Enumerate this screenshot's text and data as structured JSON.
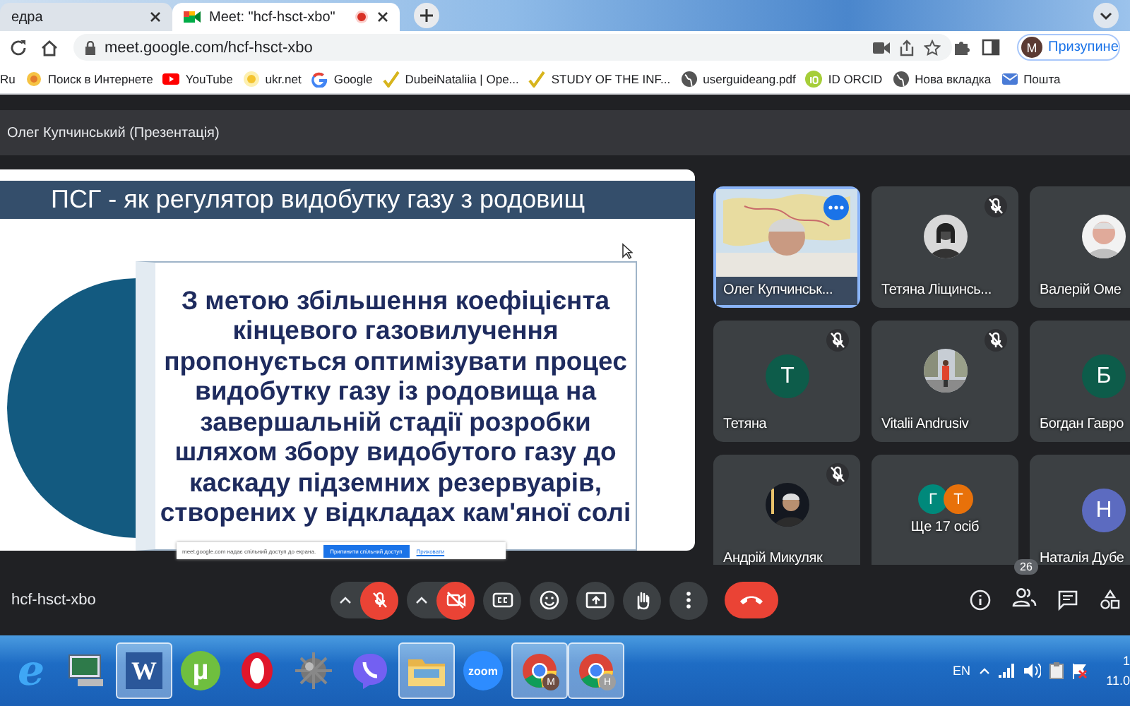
{
  "browser": {
    "tabs": [
      {
        "title": "едра",
        "selected": false,
        "recording": false
      },
      {
        "title": "Meet: \"hcf-hsct-xbo\"",
        "selected": true,
        "recording": true
      }
    ],
    "address": "meet.google.com/hcf-hsct-xbo",
    "profile": {
      "initial": "M",
      "label": "Призупине"
    },
    "bookmarks": [
      {
        "label": "Ru",
        "kind": "none"
      },
      {
        "label": "Поиск в Интернете",
        "kind": "search"
      },
      {
        "label": "YouTube",
        "kind": "youtube"
      },
      {
        "label": "ukr.net",
        "kind": "ukrnet"
      },
      {
        "label": "Google",
        "kind": "google"
      },
      {
        "label": "DubeiNataliia | Ope...",
        "kind": "pen"
      },
      {
        "label": "STUDY OF THE INF...",
        "kind": "pen"
      },
      {
        "label": "userguideang.pdf",
        "kind": "globe"
      },
      {
        "label": "ID ORCID",
        "kind": "orcid"
      },
      {
        "label": "Нова вкладка",
        "kind": "globe"
      },
      {
        "label": "Пошта",
        "kind": "mail"
      }
    ]
  },
  "meet": {
    "header_title": "Олег Купчинський (Презентація)",
    "slide": {
      "title": "ПСГ - як регулятор видобутку газу з родовищ",
      "body": "З метою збільшення коефіцієнта кінцевого газовилучення пропонується оптимізувати  процес видобутку газу із родовища на завершальній стадії розробки шляхом збору видобутого газу до каскаду підземних резервуарів, створених у відкладах кам'яної солі"
    },
    "share_banner": {
      "message": "meet.google.com надає спільний доступ до екрана.",
      "stop_button": "Припинити спільний доступ",
      "hide_link": "Приховати"
    },
    "participants": [
      {
        "kind": "video",
        "name": "Олег Купчинськ...",
        "muted": false,
        "highlighted": true
      },
      {
        "kind": "picture",
        "name": "Тетяна Ліщинсь...",
        "muted": true,
        "highlighted": false
      },
      {
        "kind": "picture",
        "name": "Валерій Оме",
        "muted": false,
        "highlighted": false
      },
      {
        "kind": "letter",
        "name": "Тетяна",
        "initial": "Т",
        "color": "#0d5c4a",
        "muted": true,
        "highlighted": false
      },
      {
        "kind": "picture",
        "name": "Vitalii Andrusiv",
        "muted": true,
        "highlighted": false
      },
      {
        "kind": "letter",
        "name": "Богдан Гавро",
        "initial": "Б",
        "color": "#0d5c4a",
        "muted": false,
        "highlighted": false
      },
      {
        "kind": "picture",
        "name": "Андрій Микуляк",
        "muted": true,
        "highlighted": false
      },
      {
        "kind": "more",
        "name": "Ще 17 осіб",
        "avatars": [
          {
            "initial": "Г",
            "color": "#00897b"
          },
          {
            "initial": "Т",
            "color": "#e8710a"
          }
        ],
        "muted": false,
        "highlighted": false
      },
      {
        "kind": "letter",
        "name": "Наталія Дубе",
        "initial": "Н",
        "color": "#5c6bc0",
        "muted": false,
        "highlighted": false
      }
    ],
    "meeting_code": "hcf-hsct-xbo",
    "mic_on": false,
    "camera_on": false,
    "participants_count": "26"
  },
  "taskbar": {
    "apps": [
      {
        "kind": "ie",
        "label": "e",
        "active": false
      },
      {
        "kind": "computer",
        "active": false
      },
      {
        "kind": "word",
        "label": "W",
        "active": true
      },
      {
        "kind": "utorrent",
        "label": "µ",
        "active": false
      },
      {
        "kind": "opera",
        "active": false
      },
      {
        "kind": "ball",
        "active": false
      },
      {
        "kind": "viber",
        "active": false
      },
      {
        "kind": "folder",
        "active": true
      },
      {
        "kind": "zoom",
        "label": "zoom",
        "active": false
      },
      {
        "kind": "chrome",
        "label": "M",
        "active": true
      },
      {
        "kind": "chrome",
        "label": "H",
        "active": true
      }
    ],
    "language": "EN",
    "clock": [
      "1",
      "11.0"
    ]
  }
}
